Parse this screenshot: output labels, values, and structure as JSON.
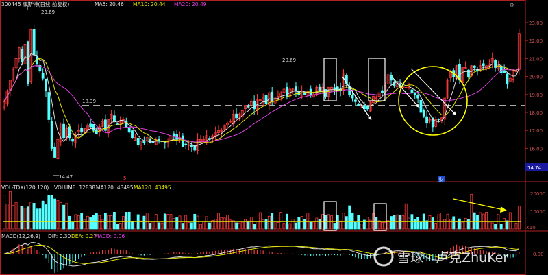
{
  "header": {
    "stock": "300445 康斯特(日线 前复权)",
    "ma5": "MA5: 20.46",
    "ma10": "MA10: 20.44",
    "ma20": "MA20: 20.49"
  },
  "vol_header": {
    "name": "VOL-TDX(120,120)",
    "volume": "VOLUME: 128381",
    "ma120a": "MA120: 43495",
    "ma120b": "MA120: 43495"
  },
  "macd_header": {
    "name": "MACD(12,26,9)",
    "dif": "DIF: 0.30",
    "dea": "DEA: 0.27",
    "macd": "MACD: 0.06"
  },
  "annotations": {
    "high": "23.69",
    "low": "14.47",
    "level_high": "20.69",
    "level_low": "18.39",
    "current": "14.74",
    "vol_unit": "X10",
    "marker": "5",
    "event": "财"
  },
  "watermark": {
    "text": "雪球 · 卢克ZhuKer"
  },
  "colors": {
    "up": "#ff3c3c",
    "down": "#54ffff",
    "ma5": "#e0e0e0",
    "ma10": "#e6e600",
    "ma20": "#e040e0",
    "axis": "#b02020",
    "circle": "#ffff00",
    "arrow": "#ffff00"
  },
  "chart_data": [
    {
      "type": "candlestick",
      "title": "300445 康斯特(日线 前复权)",
      "y_ticks": [
        16.0,
        17.0,
        18.0,
        19.0,
        20.0,
        21.0,
        22.0,
        23.0
      ],
      "ylim": [
        14.0,
        24.0
      ],
      "close": [
        18.6,
        19.2,
        19.8,
        20.4,
        21.0,
        21.6,
        20.8,
        21.8,
        19.6,
        22.6,
        21.2,
        20.7,
        20.3,
        19.9,
        19.2,
        17.6,
        16.0,
        15.5,
        16.5,
        17.3,
        16.6,
        17.1,
        16.6,
        16.4,
        16.8,
        17.0,
        16.9,
        17.1,
        17.3,
        17.2,
        17.0,
        16.8,
        17.2,
        17.5,
        17.0,
        17.6,
        17.9,
        17.5,
        17.3,
        17.5,
        17.6,
        17.2,
        16.9,
        16.6,
        16.6,
        16.2,
        16.4,
        16.3,
        16.6,
        16.3,
        16.3,
        16.5,
        16.4,
        16.4,
        16.3,
        16.4,
        16.7,
        16.7,
        16.5,
        16.6,
        16.1,
        16.2,
        16.2,
        16.1,
        15.9,
        16.5,
        16.5,
        16.5,
        16.7,
        16.5,
        16.7,
        16.9,
        17.0,
        17.0,
        17.3,
        17.4,
        17.5,
        17.9,
        17.7,
        17.9,
        18.1,
        18.4,
        18.3,
        18.6,
        18.2,
        18.7,
        18.7,
        18.8,
        18.5,
        19.1,
        18.6,
        18.8,
        18.9,
        19.1,
        19.3,
        18.9,
        19.3,
        19.3,
        19.2,
        19.0,
        19.2,
        19.0,
        19.2,
        19.0,
        19.0,
        19.4,
        19.2,
        19.4,
        18.9,
        19.4,
        19.4,
        19.3,
        19.2,
        19.2,
        20.2,
        19.6,
        19.0,
        18.8,
        18.6,
        18.4,
        18.4,
        18.2,
        18.2,
        18.6,
        18.9,
        18.8,
        19.1,
        19.1,
        19.5,
        20.1,
        19.8,
        19.5,
        19.7,
        19.4,
        19.4,
        19.4,
        19.4,
        19.1,
        19.0,
        18.8,
        18.0,
        17.8,
        17.4,
        17.6,
        17.2,
        17.6,
        17.6,
        17.7,
        18.8,
        19.8,
        20.3,
        20.0,
        20.6,
        19.8,
        20.5,
        20.5,
        20.0,
        20.6,
        20.5,
        20.3,
        20.6,
        20.6,
        20.6,
        20.7,
        21.0,
        20.5,
        20.6,
        20.2,
        20.2,
        19.6,
        19.9,
        20.2,
        20.3,
        22.4
      ],
      "events": [
        "5",
        "财"
      ]
    },
    {
      "type": "bar",
      "title": "VOL-TDX(120,120)",
      "y_ticks": [
        10000,
        20000
      ],
      "volume_max": 128381,
      "ma120": 43495,
      "unit": "X10"
    },
    {
      "type": "bar",
      "title": "MACD(12,26,9)",
      "y_ticks": [
        0.0
      ],
      "series": [
        {
          "name": "DIF",
          "last": 0.3
        },
        {
          "name": "DEA",
          "last": 0.27
        },
        {
          "name": "MACD",
          "last": 0.06
        }
      ]
    }
  ]
}
